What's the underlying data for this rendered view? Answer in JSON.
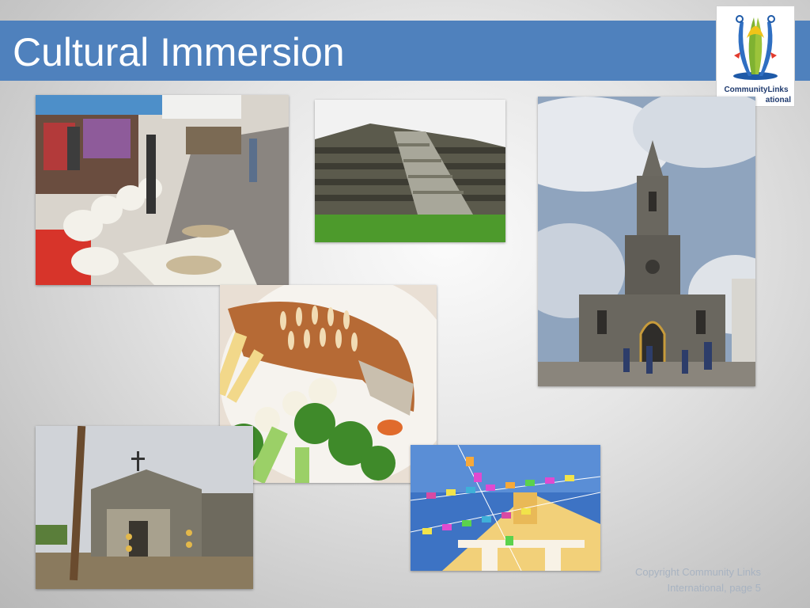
{
  "slide": {
    "title": "Cultural Immersion"
  },
  "logo": {
    "line1": "CommunityLinks",
    "line2": "ational"
  },
  "footer": {
    "line1": "Copyright Community Links",
    "line2": "International, page 5"
  },
  "colors": {
    "title_bar": "#4f81bd",
    "title_text": "#ffffff",
    "footer_text": "#a8b3c1"
  }
}
